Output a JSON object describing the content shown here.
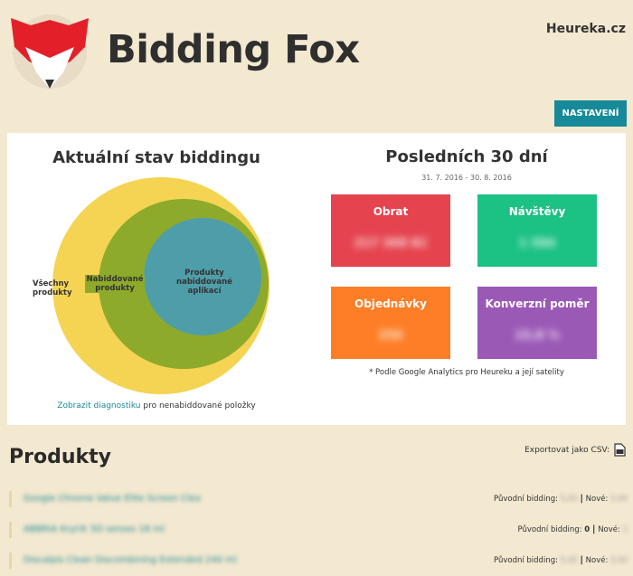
{
  "header": {
    "brand": "Bidding Fox",
    "site": "Heureka.cz",
    "settings_label": "NASTAVENÍ"
  },
  "bidding_state": {
    "title": "Aktuální stav biddingu",
    "venn": {
      "outer_label": "Všechny produkty",
      "middle_label": "Nabiddované produkty",
      "inner_label": "Produkty nabiddované aplikací",
      "colors": {
        "outer": "#f5d453",
        "middle": "#8eaa2b",
        "inner": "#4e9ea9"
      }
    },
    "diagnostics_link": "Zobrazit diagnostiku",
    "diagnostics_text": "pro nenabiddované položky"
  },
  "last30": {
    "title": "Posledních 30 dní",
    "date_range": "31. 7. 2016 - 30. 8. 2016",
    "tiles": [
      {
        "label": "Obrat",
        "value": "217 368 Kč",
        "color": "#e5444f"
      },
      {
        "label": "Návštěvy",
        "value": "1 584",
        "color": "#1cc184"
      },
      {
        "label": "Objednávky",
        "value": "250",
        "color": "#fd7e27"
      },
      {
        "label": "Konverzní poměr",
        "value": "15,8 %",
        "color": "#9b59b6"
      }
    ],
    "note": "* Podle Google Analytics pro Heureku a její satelity"
  },
  "products": {
    "title": "Produkty",
    "export_label": "Exportovat jako CSV:",
    "original_bid_label": "Původní bidding:",
    "new_bid_label": "Nové:",
    "rows": [
      {
        "name": "Google Chrome Value Elite Screen Cleo",
        "original": "5,00",
        "new": "5,00"
      },
      {
        "name": "ABBRIA Kryt® 5D seroxo 18 ml",
        "original": "0",
        "new": "1"
      },
      {
        "name": "Discalpis Clean Discombining Extended 240 ml",
        "original": "5,00",
        "new": "5,00"
      }
    ]
  }
}
